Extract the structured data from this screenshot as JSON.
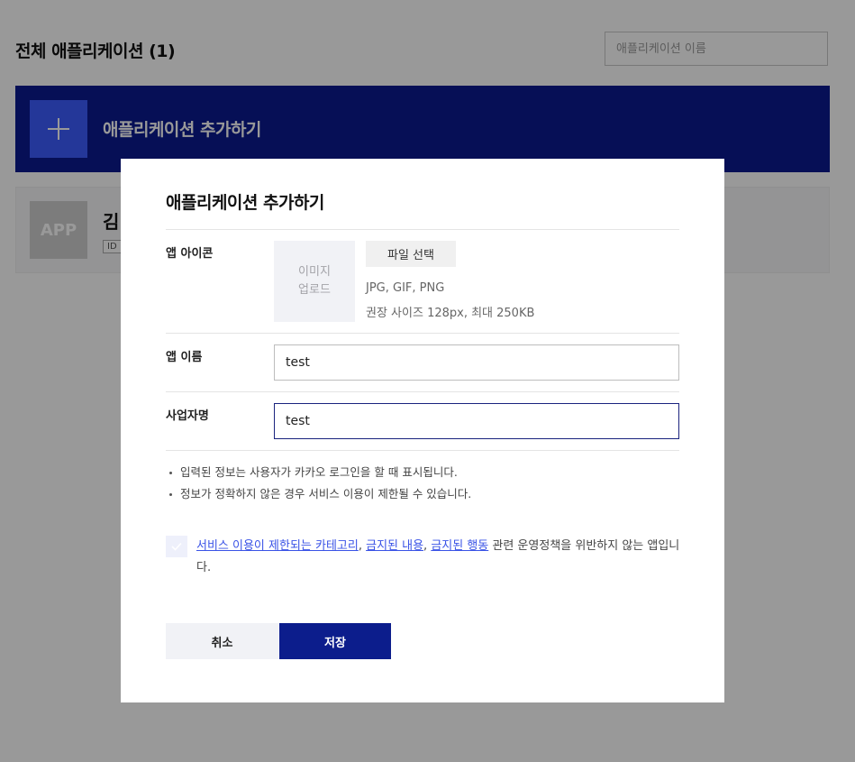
{
  "page": {
    "title": "전체 애플리케이션 (1)",
    "search": {
      "placeholder": "애플리케이션 이름",
      "value": ""
    },
    "add_banner": {
      "label": "애플리케이션 추가하기",
      "icon": "plus-icon"
    },
    "app_card": {
      "icon_text": "APP",
      "name": "김",
      "id_label": "ID"
    }
  },
  "modal": {
    "title": "애플리케이션 추가하기",
    "icon_field": {
      "label": "앱 아이콘",
      "upload_line1": "이미지",
      "upload_line2": "업로드",
      "file_button": "파일 선택",
      "hint_formats": "JPG, GIF, PNG",
      "hint_size": "권장 사이즈 128px, 최대 250KB"
    },
    "name_field": {
      "label": "앱 이름",
      "value": "test"
    },
    "company_field": {
      "label": "사업자명",
      "value": "test"
    },
    "notes": [
      "입력된 정보는 사용자가 카카오 로그인을 할 때 표시됩니다.",
      "정보가 정확하지 않은 경우 서비스 이용이 제한될 수 있습니다."
    ],
    "agreement": {
      "checked": false,
      "link1": "서비스 이용이 제한되는 카테고리",
      "sep1": ", ",
      "link2": "금지된 내용",
      "sep2": ", ",
      "link3": "금지된 행동",
      "rest": " 관련 운영정책을 위반하지 않는 앱입니다."
    },
    "buttons": {
      "cancel": "취소",
      "save": "저장"
    }
  },
  "colors": {
    "banner": "#0a1a8f",
    "plus_box": "#3d5cff",
    "save_button": "#0c1d8c",
    "link": "#3a53e6",
    "overlay": "rgba(0,0,0,0.40)"
  }
}
